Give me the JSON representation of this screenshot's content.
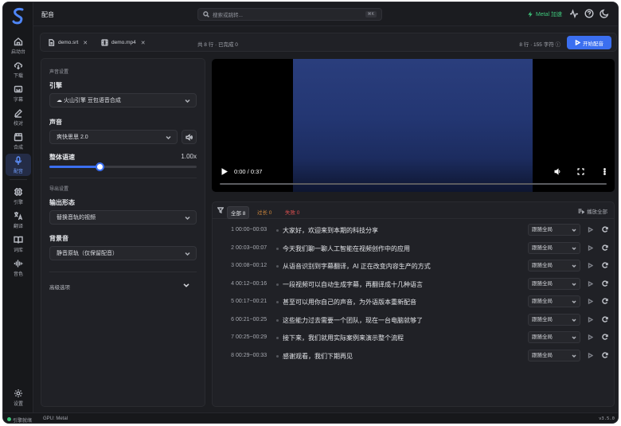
{
  "app": {
    "page_title": "配音",
    "version": "v3.5.0"
  },
  "search": {
    "placeholder": "搜索或跳转...",
    "shortcut": "⌘K"
  },
  "topbar": {
    "metal_label": "Metal 加速",
    "icons": [
      "activity-icon",
      "help-icon",
      "theme-toggle-icon"
    ]
  },
  "rail": {
    "items": [
      {
        "id": "home",
        "label": "启动台",
        "icon": "home-icon"
      },
      {
        "id": "download",
        "label": "下载",
        "icon": "cloud-download-icon"
      },
      {
        "id": "subtitle",
        "label": "字幕",
        "icon": "subtitles-icon"
      },
      {
        "id": "proofread",
        "label": "校对",
        "icon": "pen-icon"
      },
      {
        "id": "compose",
        "label": "合成",
        "icon": "clapper-icon"
      },
      {
        "id": "dubbing",
        "label": "配音",
        "icon": "mic-icon",
        "active": true
      },
      {
        "id": "engine",
        "label": "引擎",
        "icon": "chip-icon"
      },
      {
        "id": "translate",
        "label": "翻译",
        "icon": "translate-icon"
      },
      {
        "id": "glossary",
        "label": "词库",
        "icon": "book-icon"
      },
      {
        "id": "voice",
        "label": "音色",
        "icon": "waveform-icon"
      }
    ],
    "settings_label": "设置"
  },
  "filebar": {
    "files": [
      {
        "name": "demo.srt",
        "icon": "file-icon"
      },
      {
        "name": "demo.mp4",
        "icon": "film-icon"
      }
    ],
    "summary": "共 8 行 · 已完成 0",
    "stats": "8 行 · 155 字符 ⓘ",
    "start_label": "开始配音"
  },
  "settings": {
    "voice_section": "声音设置",
    "engine_label": "引擎",
    "engine_value": "☁ 火山引擎 豆包语音合成",
    "voice_label": "声音",
    "voice_value": "爽快思思 2.0",
    "speed_label": "整体语速",
    "speed_value": "1.00x",
    "speed_fraction": 0.34,
    "export_section": "导出设置",
    "output_label": "输出形态",
    "output_value": "替换音轨的视频",
    "bgm_label": "背景音",
    "bgm_value": "静音原轨（仅保留配音）",
    "advanced_label": "高级选项"
  },
  "video": {
    "time": "0:00 / 0:37",
    "progress": 0
  },
  "list": {
    "tabs": {
      "all": "全部 8",
      "too_long": "过长 0",
      "failed": "失败 0"
    },
    "play_all": "播放全部",
    "rows": [
      {
        "num": "1",
        "time": "00:00~00:03",
        "text": "大家好，欢迎来到本期的科技分享",
        "mode": "跟随全局"
      },
      {
        "num": "2",
        "time": "00:03~00:07",
        "text": "今天我们聊一聊人工智能在视频创作中的应用",
        "mode": "跟随全局"
      },
      {
        "num": "3",
        "time": "00:08~00:12",
        "text": "从语音识别到字幕翻译，AI 正在改变内容生产的方式",
        "mode": "跟随全局"
      },
      {
        "num": "4",
        "time": "00:12~00:16",
        "text": "一段视频可以自动生成字幕，再翻译成十几种语言",
        "mode": "跟随全局"
      },
      {
        "num": "5",
        "time": "00:17~00:21",
        "text": "甚至可以用你自己的声音，为外语版本重新配音",
        "mode": "跟随全局"
      },
      {
        "num": "6",
        "time": "00:21~00:25",
        "text": "这些能力过去需要一个团队，现在一台电脑就够了",
        "mode": "跟随全局"
      },
      {
        "num": "7",
        "time": "00:25~00:29",
        "text": "接下来，我们就用实际案例来演示整个流程",
        "mode": "跟随全局"
      },
      {
        "num": "8",
        "time": "00:29~00:33",
        "text": "感谢观看，我们下期再见",
        "mode": "跟随全局"
      }
    ]
  },
  "status": {
    "engine_ready": "引擎就绪",
    "gpu": "GPU: Metal"
  },
  "colors": {
    "accent": "#3b6ff0",
    "success": "#3ec77b",
    "warn": "#d48a3c",
    "error": "#d94f4f"
  }
}
